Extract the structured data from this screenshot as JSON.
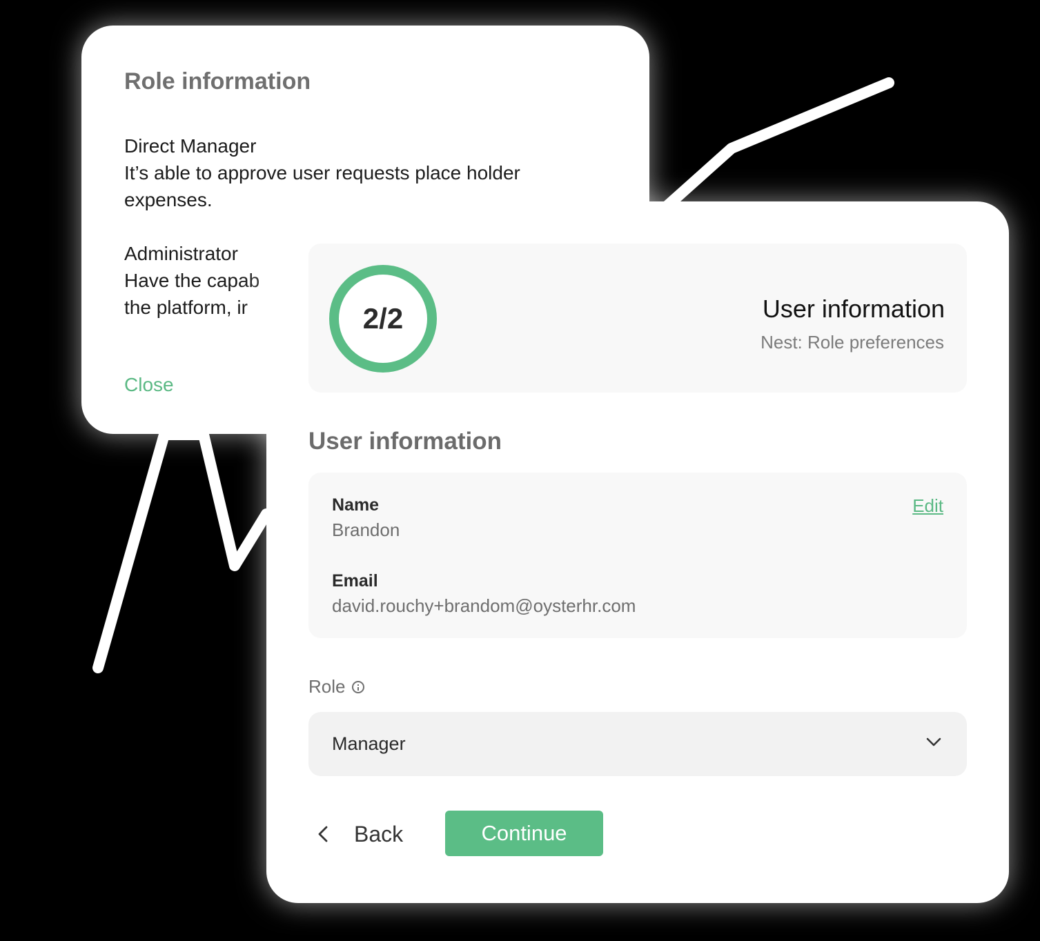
{
  "role_info": {
    "title": "Role information",
    "entries": [
      {
        "name": "Direct Manager",
        "description": "It’s able to approve user requests place holder expenses."
      },
      {
        "name": "Administrator",
        "description": "Have the capab"
      }
    ],
    "partial_line": "the platform, ir",
    "close_label": "Close"
  },
  "progress": {
    "step_text": "2/2",
    "step_fraction": 1.0,
    "title": "User information",
    "next_text": "Nest: Role preferences"
  },
  "user_info": {
    "section_title": "User information",
    "name_label": "Name",
    "name_value": "Brandon",
    "email_label": "Email",
    "email_value": "david.rouchy+brandom@oysterhr.com",
    "edit_label": "Edit"
  },
  "role_field": {
    "label": "Role",
    "selected": "Manager",
    "info_icon": "info-circle-icon",
    "chevron_icon": "chevron-down-icon"
  },
  "actions": {
    "back_label": "Back",
    "continue_label": "Continue"
  },
  "colors": {
    "accent": "#5bbd86",
    "link": "#5bb984",
    "background": "#000000",
    "card": "#ffffff"
  }
}
